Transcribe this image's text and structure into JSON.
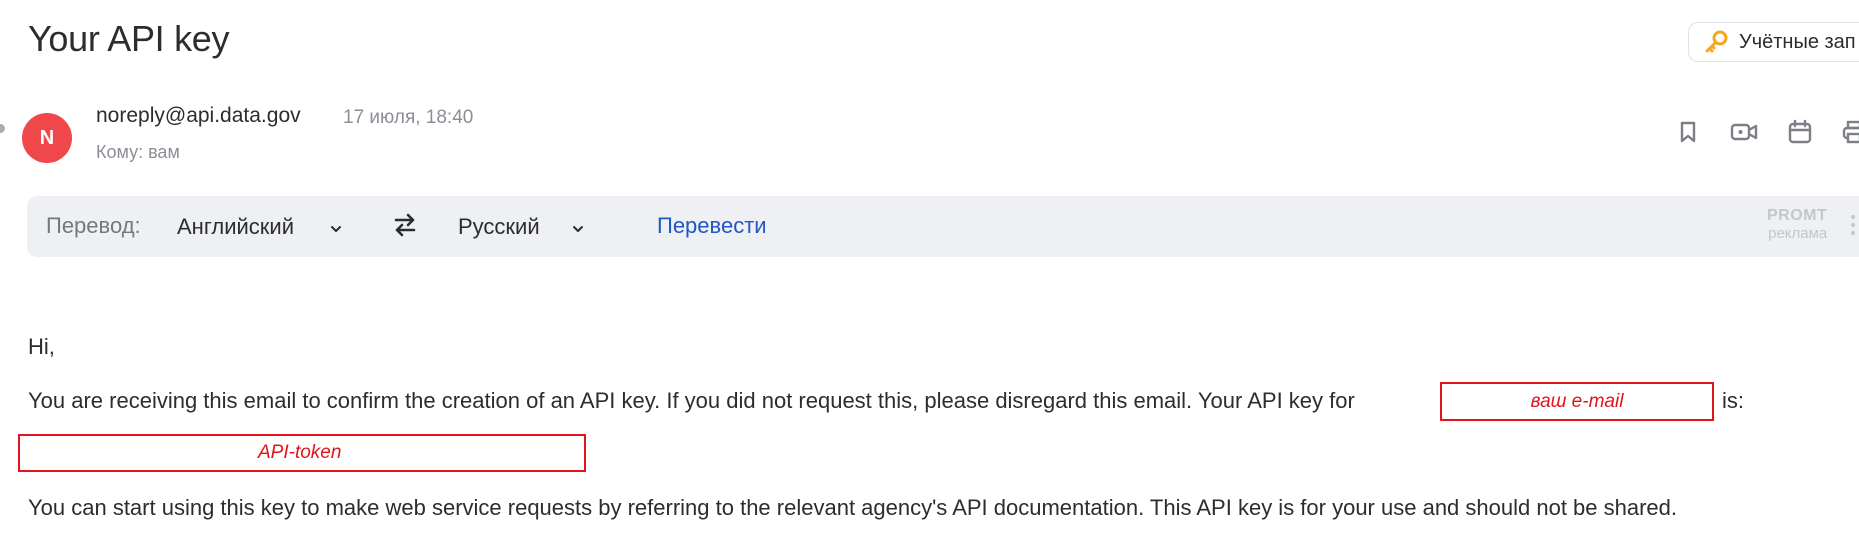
{
  "email": {
    "subject": "Your API key",
    "accounts_button": "Учётные зап",
    "sender": {
      "avatar_letter": "N",
      "address": "noreply@api.data.gov",
      "date": "17 июля, 18:40",
      "to": "Кому: вам"
    }
  },
  "translate_bar": {
    "label": "Перевод:",
    "from_lang": "Английский",
    "to_lang": "Русский",
    "action": "Перевести",
    "ad_brand": "PROMT",
    "ad_label": "реклама"
  },
  "body": {
    "greeting": "Hi,",
    "line1": "You are receiving this email to confirm the creation of an API key. If you did not request this, please disregard this email. Your API key for",
    "email_placeholder": "ваш e-mail",
    "line1_tail": "is:",
    "token_placeholder": "API-token",
    "line2": "You can start using this key to make web service requests by referring to the relevant agency's API documentation. This API key is for your use and should not be shared."
  },
  "icons": {
    "accounts": "key-icon",
    "actions": [
      "bookmark-icon",
      "video-icon",
      "calendar-icon",
      "print-icon"
    ],
    "swap": "swap-arrows-icon",
    "menu": "more-vertical-icon"
  },
  "colors": {
    "avatar": "#f0474a",
    "link": "#2157c2",
    "redaction": "#e1141b",
    "accent_key": "#f5a623"
  }
}
